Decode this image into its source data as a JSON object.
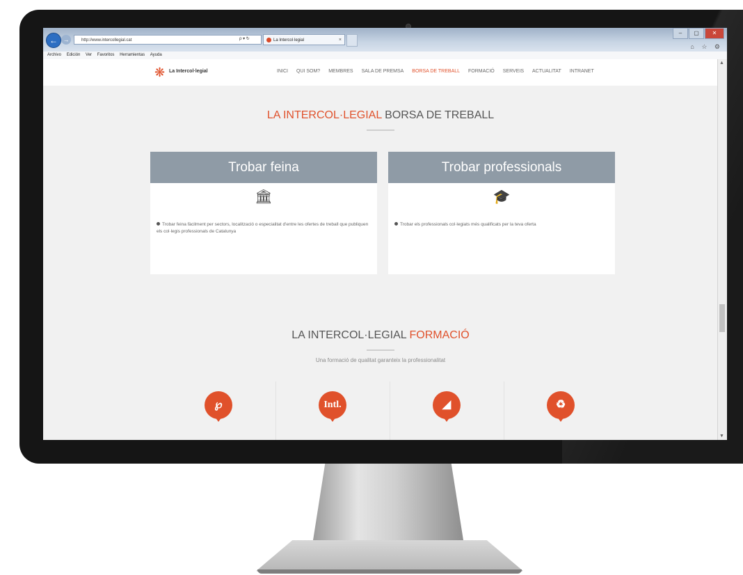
{
  "browser": {
    "address": "http://www.intercollegial.cat",
    "address_controls": "ρ ▾ ↻",
    "tab_title": "La Intercol·legial",
    "tab_close": "×",
    "window_buttons": [
      "–",
      "▢",
      "✕"
    ],
    "tool_icons": "⌂ ☆ ⚙",
    "menu": [
      "Archivo",
      "Edición",
      "Ver",
      "Favoritos",
      "Herramientas",
      "Ayuda"
    ]
  },
  "site": {
    "logo_mark": "❋",
    "logo_text": "La Intercol·legial",
    "nav": [
      {
        "label": "INICI",
        "active": false
      },
      {
        "label": "QUI SOM?",
        "active": false
      },
      {
        "label": "MEMBRES",
        "active": false
      },
      {
        "label": "SALA DE PREMSA",
        "active": false
      },
      {
        "label": "BORSA DE TREBALL",
        "active": true
      },
      {
        "label": "FORMACIÓ",
        "active": false
      },
      {
        "label": "SERVEIS",
        "active": false
      },
      {
        "label": "ACTUALITAT",
        "active": false
      },
      {
        "label": "INTRANET",
        "active": false
      }
    ]
  },
  "borsa": {
    "title_accent": "LA INTERCOL·LEGIAL",
    "title_rest": " BORSA DE TREBALL",
    "cards": [
      {
        "heading": "Trobar feina",
        "icon": "bank-icon",
        "icon_glyph": "🏛",
        "text": "Trobar feina fàcilment per sectors, localització o especialitat d'entre les ofertes de treball que publiquen els col·legis professionals de Catalunya"
      },
      {
        "heading": "Trobar professionals",
        "icon": "graduation-cap-icon",
        "icon_glyph": "🎓",
        "text": "Trobar els professionals col·legiats més qualificats per la teva oferta"
      }
    ]
  },
  "formacio": {
    "title_prefix": "LA INTERCOL·LEGIAL ",
    "title_accent": "FORMACIÓ",
    "subtitle": "Una formació de qualitat garanteix la professionalitat",
    "items": [
      {
        "icon": "pin-icon",
        "glyph": "℘"
      },
      {
        "icon": "intl-icon",
        "glyph": "Intl."
      },
      {
        "icon": "chart-icon",
        "glyph": "◢"
      },
      {
        "icon": "recycle-icon",
        "glyph": "♻"
      }
    ]
  },
  "colors": {
    "accent": "#e0512b",
    "card_header": "#8f9ba6",
    "bezel": "#151515"
  }
}
